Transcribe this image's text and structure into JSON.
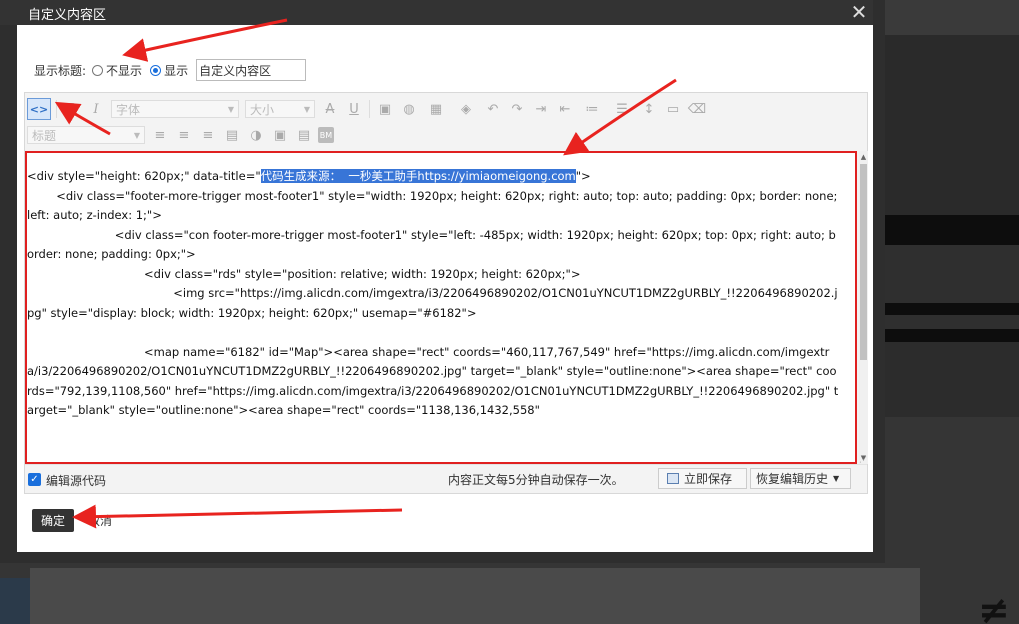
{
  "dialog": {
    "title": "自定义内容区",
    "close_glyph": "✕"
  },
  "title_row": {
    "label": "显示标题:",
    "options": [
      {
        "label": "不显示",
        "selected": false
      },
      {
        "label": "显示",
        "selected": true
      }
    ],
    "title_value": "自定义内容区"
  },
  "toolbar": {
    "row1": [
      {
        "name": "source-code-icon",
        "glyph": "<>",
        "active": true
      },
      {
        "name": "bold-icon",
        "glyph": "B"
      },
      {
        "name": "italic-icon",
        "glyph": "I"
      },
      {
        "name": "font-family-select",
        "label": "字体"
      },
      {
        "name": "font-size-select",
        "label": "大小"
      },
      {
        "name": "strikethrough-icon",
        "glyph": "A"
      },
      {
        "name": "underline-icon",
        "glyph": "U"
      },
      {
        "name": "image-icon",
        "glyph": "▣"
      },
      {
        "name": "globe-link-icon",
        "glyph": "◍"
      },
      {
        "name": "text-color-icon",
        "glyph": "▦"
      },
      {
        "name": "background-color-icon",
        "glyph": "◈"
      },
      {
        "name": "undo-icon",
        "glyph": "↶"
      },
      {
        "name": "redo-icon",
        "glyph": "↷"
      },
      {
        "name": "indent-icon",
        "glyph": "⇥"
      },
      {
        "name": "outdent-icon",
        "glyph": "⇤"
      },
      {
        "name": "unordered-list-icon",
        "glyph": "≔"
      },
      {
        "name": "ordered-list-icon",
        "glyph": "☰"
      },
      {
        "name": "line-height-icon",
        "glyph": "↕"
      },
      {
        "name": "preview-icon",
        "glyph": "▭"
      },
      {
        "name": "clear-format-icon",
        "glyph": "⌫"
      }
    ],
    "row2": [
      {
        "name": "heading-select",
        "label": "标题"
      },
      {
        "name": "align-left-icon",
        "glyph": "≡"
      },
      {
        "name": "align-center-icon",
        "glyph": "≡"
      },
      {
        "name": "align-right-icon",
        "glyph": "≡"
      },
      {
        "name": "table-icon",
        "glyph": "▤"
      },
      {
        "name": "sunglasses-icon",
        "glyph": "◑"
      },
      {
        "name": "media-icon",
        "glyph": "▣"
      },
      {
        "name": "template-icon",
        "glyph": "▤"
      },
      {
        "name": "bm-icon",
        "glyph": "BM"
      }
    ]
  },
  "source_code": {
    "lines": [
      {
        "pre": "<div style=\"height: 620px;\" data-title=\"",
        "hl": "代码生成来源：  一秒美工助手https://yimiaomeigong.com",
        "post": "\">"
      },
      {
        "pre": "        <div class=\"footer-more-trigger most-footer1\" style=\"width: 1920px; height: 620px; right: auto; top: auto; padding: 0px; border: none; left: auto; z-index: 1;\">",
        "hl": "",
        "post": ""
      },
      {
        "pre": "                        <div class=\"con footer-more-trigger most-footer1\" style=\"left: -485px; width: 1920px; height: 620px; top: 0px; right: auto; border: none; padding: 0px;\">",
        "hl": "",
        "post": ""
      },
      {
        "pre": "                                <div class=\"rds\" style=\"position: relative; width: 1920px; height: 620px;\">",
        "hl": "",
        "post": ""
      },
      {
        "pre": "                                        <img src=\"https://img.alicdn.com/imgextra/i3/2206496890202/O1CN01uYNCUT1DMZ2gURBLY_!!2206496890202.jpg\" style=\"display: block; width: 1920px; height: 620px;\" usemap=\"#6182\">",
        "hl": "",
        "post": ""
      },
      {
        "pre": "",
        "hl": "",
        "post": ""
      },
      {
        "pre": "                                <map name=\"6182\" id=\"Map\"><area shape=\"rect\" coords=\"460,117,767,549\" href=\"https://img.alicdn.com/imgextra/i3/2206496890202/O1CN01uYNCUT1DMZ2gURBLY_!!2206496890202.jpg\" target=\"_blank\" style=\"outline:none\"><area shape=\"rect\" coords=\"792,139,1108,560\" href=\"https://img.alicdn.com/imgextra/i3/2206496890202/O1CN01uYNCUT1DMZ2gURBLY_!!2206496890202.jpg\" target=\"_blank\" style=\"outline:none\"><area shape=\"rect\" coords=\"1138,136,1432,558\"",
        "hl": "",
        "post": ""
      }
    ]
  },
  "statusbar": {
    "checkbox_label": "编辑源代码",
    "checkbox_checked": true,
    "autosave_text": "内容正文每5分钟自动保存一次。",
    "save_now_label": "立即保存",
    "history_label": "恢复编辑历史"
  },
  "footer": {
    "ok_label": "确定",
    "cancel_label": "取消"
  },
  "colors": {
    "highlight_border": "#e02020",
    "arrow": "#e8231f",
    "selection": "#3875d7",
    "accent": "#1a6fdc"
  }
}
